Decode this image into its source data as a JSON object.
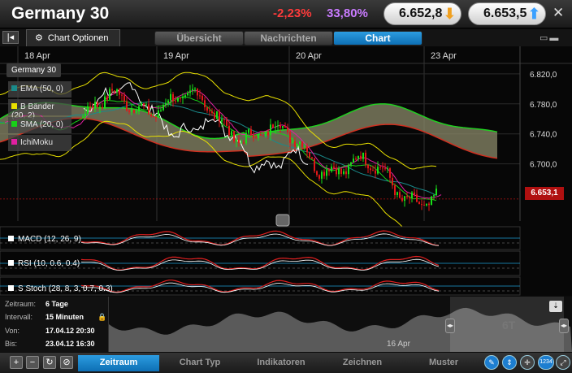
{
  "header": {
    "title": "Germany 30",
    "change_pct": "-2,23%",
    "change_vol": "33,80%",
    "bid": "6.652,8",
    "ask": "6.653,5",
    "close": "✕"
  },
  "tabs": {
    "options_label": "Chart Optionen",
    "items": [
      {
        "label": "Übersicht",
        "active": false
      },
      {
        "label": "Nachrichten",
        "active": false
      },
      {
        "label": "Chart",
        "active": true
      }
    ]
  },
  "chart": {
    "instrument_label": "Germany 30",
    "x_dates": [
      "18 Apr",
      "19 Apr",
      "20 Apr",
      "23 Apr"
    ],
    "y_ticks": [
      "6.820,0",
      "6.780,0",
      "6.740,0",
      "6.700,0"
    ],
    "last_price": "6.653,1",
    "legend": [
      {
        "label": "EMA (50, 0)",
        "color": "#1a8a8a"
      },
      {
        "label": "B Bänder (20, 2)",
        "color": "#e8e000"
      },
      {
        "label": "SMA (20, 0)",
        "color": "#18d018"
      },
      {
        "label": "IchiMoku",
        "color": "#e020a0"
      }
    ],
    "indicators": [
      {
        "label": "MACD (12, 26, 9)"
      },
      {
        "label": "RSI (10, 0.6, 0.4)"
      },
      {
        "label": "S Stoch (28, 8, 3, 0.7, 0.3)"
      }
    ]
  },
  "chart_data": {
    "type": "line",
    "x": [
      "18 Apr",
      "19 Apr",
      "20 Apr",
      "23 Apr"
    ],
    "ylim": [
      6640,
      6835
    ],
    "series": [
      {
        "name": "Germany 30",
        "values": [
          6740,
          6790,
          6700,
          6653.1
        ]
      }
    ]
  },
  "navigator": {
    "zeitraum_label": "Zeitraum:",
    "zeitraum_value": "6 Tage",
    "intervall_label": "Intervall:",
    "intervall_value": "15 Minuten",
    "von_label": "Von:",
    "von_value": "17.04.12 20:30",
    "bis_label": "Bis:",
    "bis_value": "23.04.12 16:30",
    "date_label": "16 Apr",
    "range_label": "6T"
  },
  "toolbar": {
    "tabs": [
      {
        "label": "Zeitraum",
        "active": true
      },
      {
        "label": "Chart Typ",
        "active": false
      },
      {
        "label": "Indikatoren",
        "active": false
      },
      {
        "label": "Zeichnen",
        "active": false
      },
      {
        "label": "Muster",
        "active": false
      }
    ],
    "zoom_badge": "1234"
  }
}
